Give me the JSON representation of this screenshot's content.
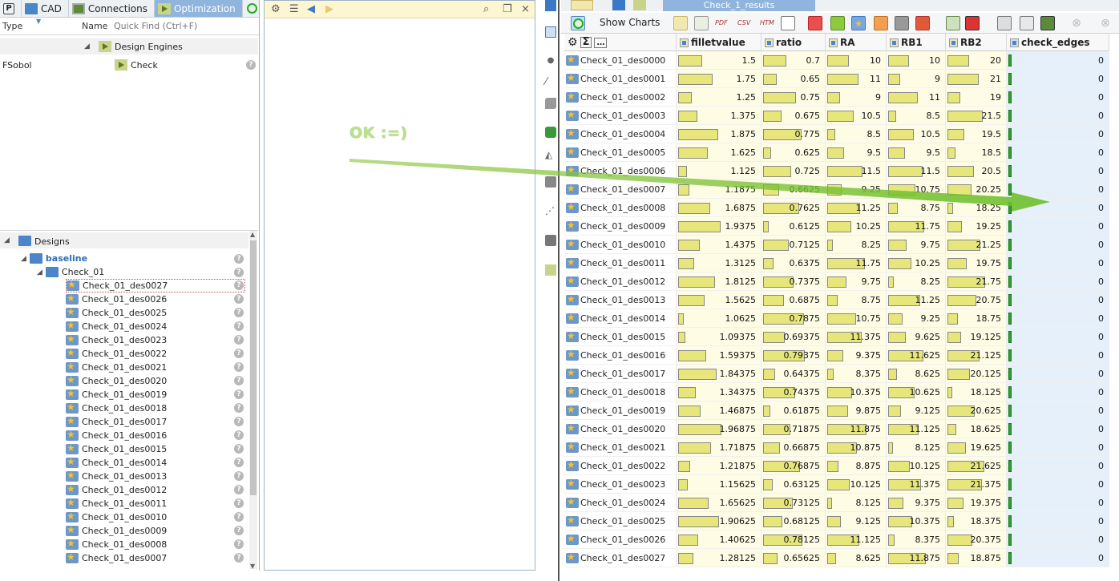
{
  "left_panel": {
    "tabs": [
      {
        "label": "",
        "icon": "p-logo-icon"
      },
      {
        "label": "CAD",
        "icon": "folder-icon"
      },
      {
        "label": "Connections",
        "icon": "monitor-icon"
      },
      {
        "label": "Optimization",
        "icon": "play-icon"
      }
    ],
    "header": {
      "type": "Type",
      "name": "Name",
      "quick_find": "Quick Find (Ctrl+F)"
    },
    "design_engines_label": "Design Engines",
    "fsobol_type": "FSobol",
    "check_label": "Check",
    "designs_label": "Designs",
    "baseline_label": "baseline",
    "check01_label": "Check_01",
    "designs": [
      "Check_01_des0027",
      "Check_01_des0026",
      "Check_01_des0025",
      "Check_01_des0024",
      "Check_01_des0023",
      "Check_01_des0022",
      "Check_01_des0021",
      "Check_01_des0020",
      "Check_01_des0019",
      "Check_01_des0018",
      "Check_01_des0017",
      "Check_01_des0016",
      "Check_01_des0015",
      "Check_01_des0014",
      "Check_01_des0013",
      "Check_01_des0012",
      "Check_01_des0011",
      "Check_01_des0010",
      "Check_01_des0009",
      "Check_01_des0008",
      "Check_01_des0007"
    ]
  },
  "results_panel": {
    "active_tab": "Check_1_results",
    "show_charts_label": "Show Charts",
    "toolbar_icon_text": {
      "pdf": "PDF",
      "csv": "CSV",
      "htm": "HTM"
    },
    "columns": [
      "filletvalue",
      "ratio",
      "RA",
      "RB1",
      "RB2",
      "check_edges"
    ],
    "rows": [
      {
        "name": "Check_01_des0000",
        "filletvalue": 1.5,
        "ratio": 0.7,
        "RA": 10,
        "RB1": 10,
        "RB2": 20,
        "check_edges": 0
      },
      {
        "name": "Check_01_des0001",
        "filletvalue": 1.75,
        "ratio": 0.65,
        "RA": 11,
        "RB1": 9,
        "RB2": 21,
        "check_edges": 0
      },
      {
        "name": "Check_01_des0002",
        "filletvalue": 1.25,
        "ratio": 0.75,
        "RA": 9,
        "RB1": 11,
        "RB2": 19,
        "check_edges": 0
      },
      {
        "name": "Check_01_des0003",
        "filletvalue": 1.375,
        "ratio": 0.675,
        "RA": 10.5,
        "RB1": 8.5,
        "RB2": 21.5,
        "check_edges": 0
      },
      {
        "name": "Check_01_des0004",
        "filletvalue": 1.875,
        "ratio": 0.775,
        "RA": 8.5,
        "RB1": 10.5,
        "RB2": 19.5,
        "check_edges": 0
      },
      {
        "name": "Check_01_des0005",
        "filletvalue": 1.625,
        "ratio": 0.625,
        "RA": 9.5,
        "RB1": 9.5,
        "RB2": 18.5,
        "check_edges": 0
      },
      {
        "name": "Check_01_des0006",
        "filletvalue": 1.125,
        "ratio": 0.725,
        "RA": 11.5,
        "RB1": 11.5,
        "RB2": 20.5,
        "check_edges": 0
      },
      {
        "name": "Check_01_des0007",
        "filletvalue": 1.1875,
        "ratio": 0.6625,
        "RA": 9.25,
        "RB1": 10.75,
        "RB2": 20.25,
        "check_edges": 0
      },
      {
        "name": "Check_01_des0008",
        "filletvalue": 1.6875,
        "ratio": 0.7625,
        "RA": 11.25,
        "RB1": 8.75,
        "RB2": 18.25,
        "check_edges": 0
      },
      {
        "name": "Check_01_des0009",
        "filletvalue": 1.9375,
        "ratio": 0.6125,
        "RA": 10.25,
        "RB1": 11.75,
        "RB2": 19.25,
        "check_edges": 0
      },
      {
        "name": "Check_01_des0010",
        "filletvalue": 1.4375,
        "ratio": 0.7125,
        "RA": 8.25,
        "RB1": 9.75,
        "RB2": 21.25,
        "check_edges": 0
      },
      {
        "name": "Check_01_des0011",
        "filletvalue": 1.3125,
        "ratio": 0.6375,
        "RA": 11.75,
        "RB1": 10.25,
        "RB2": 19.75,
        "check_edges": 0
      },
      {
        "name": "Check_01_des0012",
        "filletvalue": 1.8125,
        "ratio": 0.7375,
        "RA": 9.75,
        "RB1": 8.25,
        "RB2": 21.75,
        "check_edges": 0
      },
      {
        "name": "Check_01_des0013",
        "filletvalue": 1.5625,
        "ratio": 0.6875,
        "RA": 8.75,
        "RB1": 11.25,
        "RB2": 20.75,
        "check_edges": 0
      },
      {
        "name": "Check_01_des0014",
        "filletvalue": 1.0625,
        "ratio": 0.7875,
        "RA": 10.75,
        "RB1": 9.25,
        "RB2": 18.75,
        "check_edges": 0
      },
      {
        "name": "Check_01_des0015",
        "filletvalue": 1.09375,
        "ratio": 0.69375,
        "RA": 11.375,
        "RB1": 9.625,
        "RB2": 19.125,
        "check_edges": 0
      },
      {
        "name": "Check_01_des0016",
        "filletvalue": 1.59375,
        "ratio": 0.79375,
        "RA": 9.375,
        "RB1": 11.625,
        "RB2": 21.125,
        "check_edges": 0
      },
      {
        "name": "Check_01_des0017",
        "filletvalue": 1.84375,
        "ratio": 0.64375,
        "RA": 8.375,
        "RB1": 8.625,
        "RB2": 20.125,
        "check_edges": 0
      },
      {
        "name": "Check_01_des0018",
        "filletvalue": 1.34375,
        "ratio": 0.74375,
        "RA": 10.375,
        "RB1": 10.625,
        "RB2": 18.125,
        "check_edges": 0
      },
      {
        "name": "Check_01_des0019",
        "filletvalue": 1.46875,
        "ratio": 0.61875,
        "RA": 9.875,
        "RB1": 9.125,
        "RB2": 20.625,
        "check_edges": 0
      },
      {
        "name": "Check_01_des0020",
        "filletvalue": 1.96875,
        "ratio": 0.71875,
        "RA": 11.875,
        "RB1": 11.125,
        "RB2": 18.625,
        "check_edges": 0
      },
      {
        "name": "Check_01_des0021",
        "filletvalue": 1.71875,
        "ratio": 0.66875,
        "RA": 10.875,
        "RB1": 8.125,
        "RB2": 19.625,
        "check_edges": 0
      },
      {
        "name": "Check_01_des0022",
        "filletvalue": 1.21875,
        "ratio": 0.76875,
        "RA": 8.875,
        "RB1": 10.125,
        "RB2": 21.625,
        "check_edges": 0
      },
      {
        "name": "Check_01_des0023",
        "filletvalue": 1.15625,
        "ratio": 0.63125,
        "RA": 10.125,
        "RB1": 11.375,
        "RB2": 21.375,
        "check_edges": 0
      },
      {
        "name": "Check_01_des0024",
        "filletvalue": 1.65625,
        "ratio": 0.73125,
        "RA": 8.125,
        "RB1": 9.375,
        "RB2": 19.375,
        "check_edges": 0
      },
      {
        "name": "Check_01_des0025",
        "filletvalue": 1.90625,
        "ratio": 0.68125,
        "RA": 9.125,
        "RB1": 10.375,
        "RB2": 18.375,
        "check_edges": 0
      },
      {
        "name": "Check_01_des0026",
        "filletvalue": 1.40625,
        "ratio": 0.78125,
        "RA": 11.125,
        "RB1": 8.375,
        "RB2": 20.375,
        "check_edges": 0
      },
      {
        "name": "Check_01_des0027",
        "filletvalue": 1.28125,
        "ratio": 0.65625,
        "RA": 8.625,
        "RB1": 11.875,
        "RB2": 18.875,
        "check_edges": 0
      }
    ],
    "bar_ranges": {
      "filletvalue": [
        1.0,
        2.0
      ],
      "ratio": [
        0.6,
        0.8
      ],
      "RA": [
        8.0,
        12.0
      ],
      "RB1": [
        8.0,
        12.0
      ],
      "RB2": [
        18.0,
        22.0
      ]
    }
  },
  "annotation": {
    "text": "OK :=)",
    "color": "#8dc63f"
  },
  "colors": {
    "tab_active": "#8fb4dd",
    "bar_fill": "#e6e67a",
    "check_green": "#2aa52a"
  }
}
